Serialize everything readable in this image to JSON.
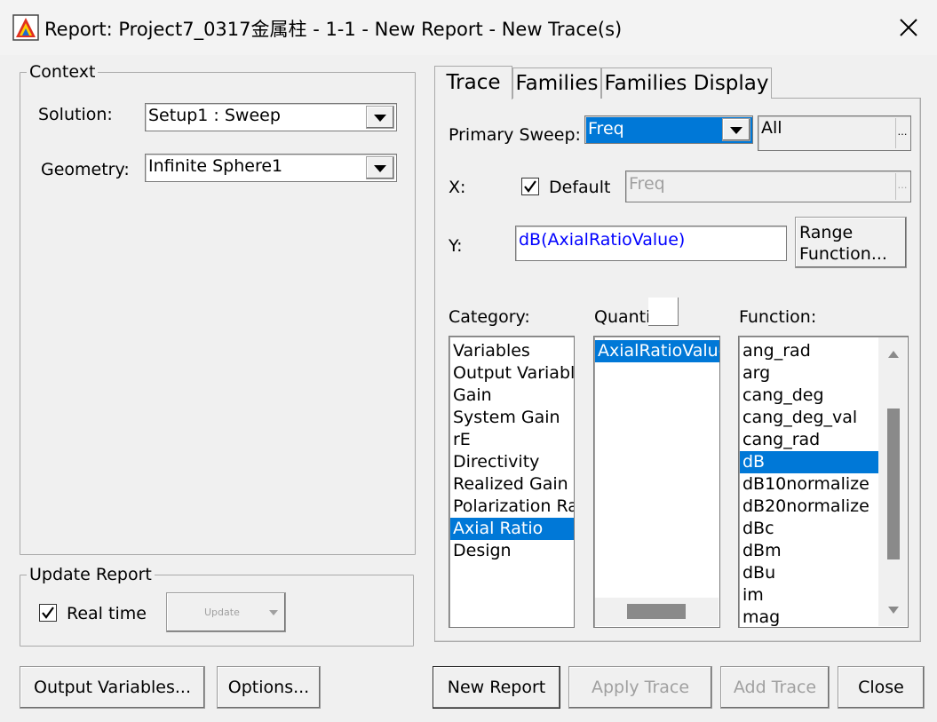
{
  "window": {
    "title": "Report: Project7_0317金属柱 - 1-1 - New Report - New Trace(s)"
  },
  "context": {
    "legend": "Context",
    "solution_label": "Solution:",
    "solution_value": "Setup1 : Sweep",
    "geometry_label": "Geometry:",
    "geometry_value": "Infinite Sphere1"
  },
  "update_report": {
    "legend": "Update Report",
    "realtime_label": "Real time",
    "realtime_checked": true,
    "update_label": "Update"
  },
  "tabs": [
    {
      "label": "Trace",
      "active": true
    },
    {
      "label": "Families",
      "active": false
    },
    {
      "label": "Families Display",
      "active": false
    }
  ],
  "trace": {
    "primary_sweep_label": "Primary Sweep:",
    "primary_sweep_value": "Freq",
    "sweep_range_value": "All",
    "x_label": "X:",
    "default_label": "Default",
    "default_checked": true,
    "x_value": "Freq",
    "y_label": "Y:",
    "y_value": "dB(AxialRatioValue)",
    "range_function_line1": "Range",
    "range_function_line2": "Function...",
    "category_label": "Category:",
    "quantity_label": "Quanti",
    "function_label": "Function:",
    "categories": [
      "Variables",
      "Output Variabl",
      "Gain",
      "System Gain",
      "rE",
      "Directivity",
      "Realized Gain",
      "Polarization Ra",
      "Axial Ratio",
      "Design"
    ],
    "selected_category": "Axial Ratio",
    "quantities": [
      "AxialRatioValue"
    ],
    "selected_quantity": "AxialRatioValue",
    "functions": [
      "ang_rad",
      "arg",
      "cang_deg",
      "cang_deg_val",
      "cang_rad",
      "dB",
      "dB10normalize",
      "dB20normalize",
      "dBc",
      "dBm",
      "dBu",
      "im",
      "mag"
    ],
    "selected_function": "dB"
  },
  "buttons": {
    "output_variables": "Output Variables...",
    "options": "Options...",
    "new_report": "New Report",
    "apply_trace": "Apply Trace",
    "add_trace": "Add Trace",
    "close": "Close"
  },
  "colors": {
    "selection": "#0078d7",
    "y_text": "#0000ff",
    "disabled_text": "#a0a0a0"
  }
}
